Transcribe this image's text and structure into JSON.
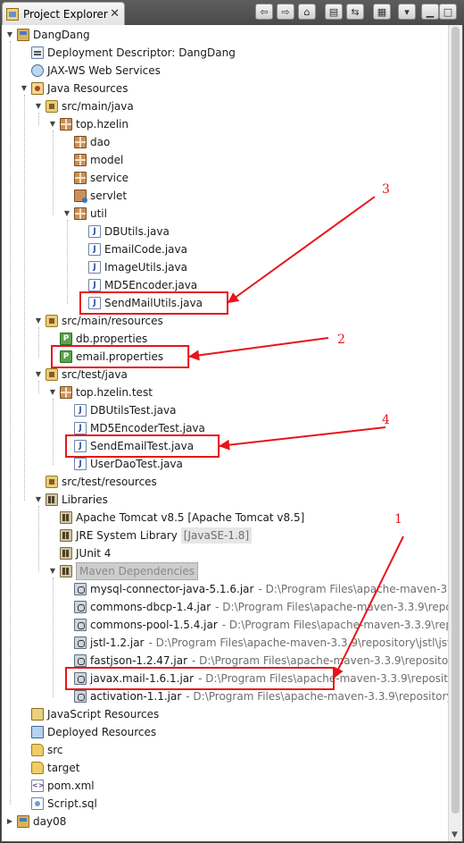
{
  "view": {
    "title": "Project Explorer",
    "close_glyph": "✕"
  },
  "toolbar": {
    "buttons": [
      {
        "icon": "back-arrow-icon",
        "glyph": "⇦"
      },
      {
        "icon": "forward-arrow-icon",
        "glyph": "⇨"
      },
      {
        "icon": "home-icon",
        "glyph": "⌂"
      },
      {
        "icon": "collapse-all-icon",
        "glyph": "▤"
      },
      {
        "icon": "link-with-editor-icon",
        "glyph": "⇆"
      },
      {
        "icon": "focus-icon",
        "glyph": "▦"
      },
      {
        "icon": "view-menu-icon",
        "glyph": "▾"
      },
      {
        "icon": "minimize-icon",
        "glyph": "▁"
      },
      {
        "icon": "maximize-icon",
        "glyph": "□"
      }
    ]
  },
  "tree": [
    {
      "label": "DangDang",
      "icon": "project",
      "twisty": "▼",
      "level": 0
    },
    {
      "label": "Deployment Descriptor: DangDang",
      "icon": "descriptor",
      "twisty": "",
      "level": 1
    },
    {
      "label": "JAX-WS Web Services",
      "icon": "ws",
      "twisty": "",
      "level": 1
    },
    {
      "label": "Java Resources",
      "icon": "resources",
      "twisty": "▼",
      "level": 1
    },
    {
      "label": "src/main/java",
      "icon": "srcfolder",
      "twisty": "▼",
      "level": 2
    },
    {
      "label": "top.hzelin",
      "icon": "package",
      "twisty": "▼",
      "level": 3
    },
    {
      "label": "dao",
      "icon": "package",
      "twisty": "",
      "level": 4
    },
    {
      "label": "model",
      "icon": "package",
      "twisty": "",
      "level": 4
    },
    {
      "label": "service",
      "icon": "package",
      "twisty": "",
      "level": 4
    },
    {
      "label": "servlet",
      "icon": "package-ro",
      "twisty": "",
      "level": 4
    },
    {
      "label": "util",
      "icon": "package",
      "twisty": "▼",
      "level": 4
    },
    {
      "label": "DBUtils.java",
      "icon": "java",
      "twisty": "",
      "level": 5
    },
    {
      "label": "EmailCode.java",
      "icon": "java",
      "twisty": "",
      "level": 5
    },
    {
      "label": "ImageUtils.java",
      "icon": "java",
      "twisty": "",
      "level": 5
    },
    {
      "label": "MD5Encoder.java",
      "icon": "java",
      "twisty": "",
      "level": 5
    },
    {
      "label": "SendMailUtils.java",
      "icon": "java",
      "twisty": "",
      "level": 5
    },
    {
      "label": "src/main/resources",
      "icon": "srcfolder",
      "twisty": "▼",
      "level": 2
    },
    {
      "label": "db.properties",
      "icon": "props",
      "twisty": "",
      "level": 3
    },
    {
      "label": "email.properties",
      "icon": "props",
      "twisty": "",
      "level": 3
    },
    {
      "label": "src/test/java",
      "icon": "srcfolder",
      "twisty": "▼",
      "level": 2
    },
    {
      "label": "top.hzelin.test",
      "icon": "package",
      "twisty": "▼",
      "level": 3
    },
    {
      "label": "DBUtilsTest.java",
      "icon": "java",
      "twisty": "",
      "level": 4
    },
    {
      "label": "MD5EncoderTest.java",
      "icon": "java",
      "twisty": "",
      "level": 4
    },
    {
      "label": "SendEmailTest.java",
      "icon": "java",
      "twisty": "",
      "level": 4
    },
    {
      "label": "UserDaoTest.java",
      "icon": "java",
      "twisty": "",
      "level": 4
    },
    {
      "label": "src/test/resources",
      "icon": "srcfolder",
      "twisty": "",
      "level": 2
    },
    {
      "label": "Libraries",
      "icon": "library",
      "twisty": "▼",
      "level": 2
    },
    {
      "label": "Apache Tomcat v8.5 [Apache Tomcat v8.5]",
      "icon": "library",
      "twisty": "",
      "level": 3
    },
    {
      "label": "JRE System Library",
      "decoration": "[JavaSE-1.8]",
      "icon": "library",
      "twisty": "",
      "level": 3
    },
    {
      "label": "JUnit 4",
      "icon": "library",
      "twisty": "",
      "level": 3
    },
    {
      "label": "Maven Dependencies",
      "icon": "library",
      "twisty": "▼",
      "level": 3,
      "selected": true
    },
    {
      "label": "mysql-connector-java-5.1.6.jar",
      "detail": "- D:\\Program Files\\apache-maven-3.3",
      "icon": "jar",
      "twisty": "",
      "level": 4
    },
    {
      "label": "commons-dbcp-1.4.jar",
      "detail": "- D:\\Program Files\\apache-maven-3.3.9\\reposito",
      "icon": "jar",
      "twisty": "",
      "level": 4
    },
    {
      "label": "commons-pool-1.5.4.jar",
      "detail": "- D:\\Program Files\\apache-maven-3.3.9\\rep",
      "icon": "jar",
      "twisty": "",
      "level": 4
    },
    {
      "label": "jstl-1.2.jar",
      "detail": "- D:\\Program Files\\apache-maven-3.3.9\\repository\\jstl\\jst",
      "icon": "jar",
      "twisty": "",
      "level": 4
    },
    {
      "label": "fastjson-1.2.47.jar",
      "detail": "- D:\\Program Files\\apache-maven-3.3.9\\repositor",
      "icon": "jar",
      "twisty": "",
      "level": 4
    },
    {
      "label": "javax.mail-1.6.1.jar",
      "detail": "- D:\\Program Files\\apache-maven-3.3.9\\reposito",
      "icon": "jar",
      "twisty": "",
      "level": 4
    },
    {
      "label": "activation-1.1.jar",
      "detail": "- D:\\Program Files\\apache-maven-3.3.9\\repository",
      "icon": "jar",
      "twisty": "",
      "level": 4
    },
    {
      "label": "JavaScript Resources",
      "icon": "jsres",
      "twisty": "",
      "level": 1
    },
    {
      "label": "Deployed Resources",
      "icon": "deployed",
      "twisty": "",
      "level": 1
    },
    {
      "label": "src",
      "icon": "folder",
      "twisty": "",
      "level": 1
    },
    {
      "label": "target",
      "icon": "folder",
      "twisty": "",
      "level": 1
    },
    {
      "label": "pom.xml",
      "icon": "xml",
      "twisty": "",
      "level": 1
    },
    {
      "label": "Script.sql",
      "icon": "sql",
      "twisty": "",
      "level": 1
    },
    {
      "label": "day08",
      "icon": "project",
      "twisty": "▶",
      "level": 0
    }
  ],
  "annotations": [
    {
      "number": "3",
      "target": "SendMailUtils.java"
    },
    {
      "number": "2",
      "target": "email.properties"
    },
    {
      "number": "4",
      "target": "SendEmailTest.java"
    },
    {
      "number": "1",
      "target": "javax.mail-1.6.1.jar"
    }
  ],
  "annotation_color": "#e8141a"
}
